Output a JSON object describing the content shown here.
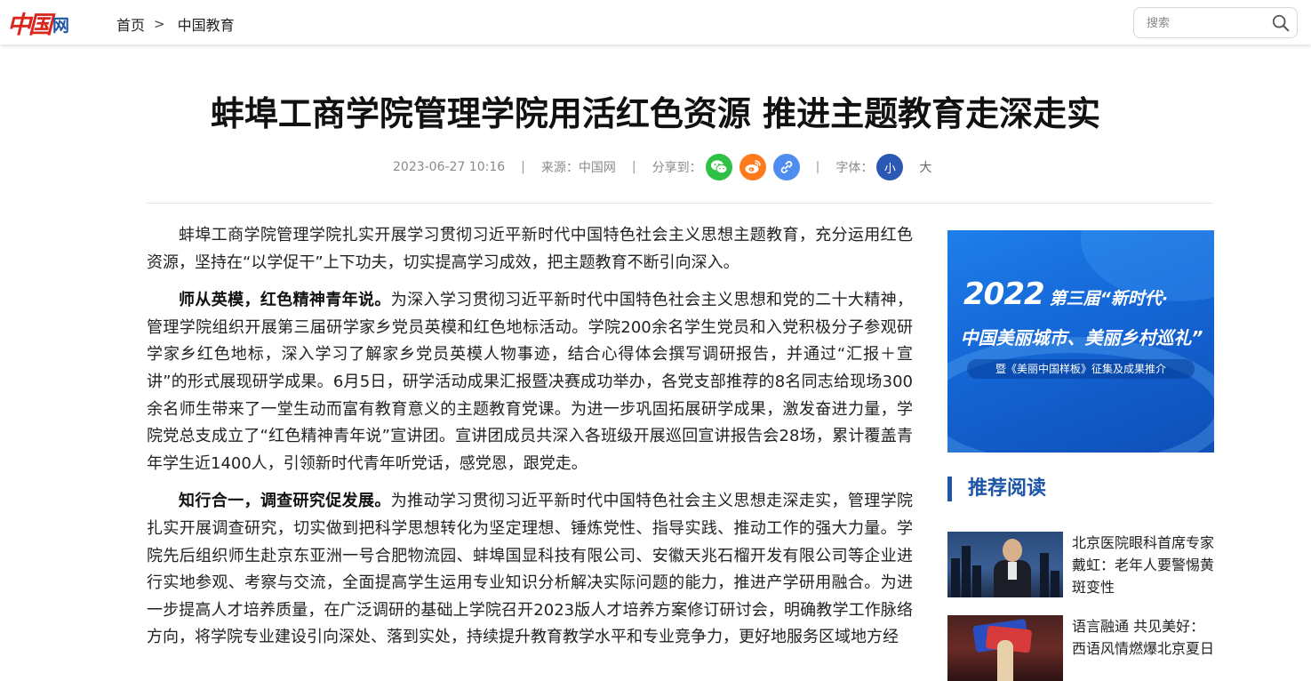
{
  "header": {
    "logo_zh": "中国",
    "logo_wang": "网",
    "breadcrumb": {
      "home": "首页",
      "separator": ">",
      "current": "中国教育"
    },
    "search": {
      "placeholder": "搜索"
    }
  },
  "article": {
    "title": "蚌埠工商学院管理学院用活红色资源 推进主题教育走深走实",
    "meta": {
      "datetime": "2023-06-27 10:16",
      "source": "来源：中国网",
      "share_label": "分享到：",
      "font_label": "字体：",
      "font_small": "小",
      "font_large": "大"
    },
    "paragraphs": [
      {
        "lead": "",
        "text": "蚌埠工商学院管理学院扎实开展学习贯彻习近平新时代中国特色社会主义思想主题教育，充分运用红色资源，坚持在“以学促干”上下功夫，切实提高学习成效，把主题教育不断引向深入。"
      },
      {
        "lead": "师从英模，红色精神青年说。",
        "text": "为深入学习贯彻习近平新时代中国特色社会主义思想和党的二十大精神，管理学院组织开展第三届研学家乡党员英模和红色地标活动。学院200余名学生党员和入党积极分子参观研学家乡红色地标，深入学习了解家乡党员英模人物事迹，结合心得体会撰写调研报告，并通过“汇报＋宣讲”的形式展现研学成果。6月5日，研学活动成果汇报暨决赛成功举办，各党支部推荐的8名同志给现场300余名师生带来了一堂生动而富有教育意义的主题教育党课。为进一步巩固拓展研学成果，激发奋进力量，学院党总支成立了“红色精神青年说”宣讲团。宣讲团成员共深入各班级开展巡回宣讲报告会28场，累计覆盖青年学生近1400人，引领新时代青年听党话，感党恩，跟党走。"
      },
      {
        "lead": "知行合一，调查研究促发展。",
        "text": "为推动学习贯彻习近平新时代中国特色社会主义思想走深走实，管理学院扎实开展调查研究，切实做到把科学思想转化为坚定理想、锤炼党性、指导实践、推动工作的强大力量。学院先后组织师生赴京东亚洲一号合肥物流园、蚌埠国显科技有限公司、安徽天兆石榴开发有限公司等企业进行实地参观、考察与交流，全面提高学生运用专业知识分析解决实际问题的能力，推进产学研用融合。为进一步提高人才培养质量，在广泛调研的基础上学院召开2023版人才培养方案修订研讨会，明确教学工作脉络方向，将学院专业建设引向深处、落到实处，持续提升教育教学水平和专业竞争力，更好地服务区域地方经"
      }
    ]
  },
  "sidebar": {
    "banner": {
      "year": "2022",
      "line1_rest": "第三届“新时代·",
      "line2": "中国美丽城市、美丽乡村巡礼”",
      "line3": "暨《美丽中国样板》征集及成果推介"
    },
    "recommend_title": "推荐阅读",
    "items": [
      {
        "title": "北京医院眼科首席专家戴虹：老年人要警惕黄斑变性"
      },
      {
        "title": "语言融通 共见美好：西语风情燃爆北京夏日"
      }
    ]
  },
  "colors": {
    "brand_red": "#d9251c",
    "brand_blue": "#1d56a6",
    "wechat_green": "#2fc145",
    "weibo_orange": "#ff7a1a",
    "link_blue": "#4f8ef0"
  }
}
